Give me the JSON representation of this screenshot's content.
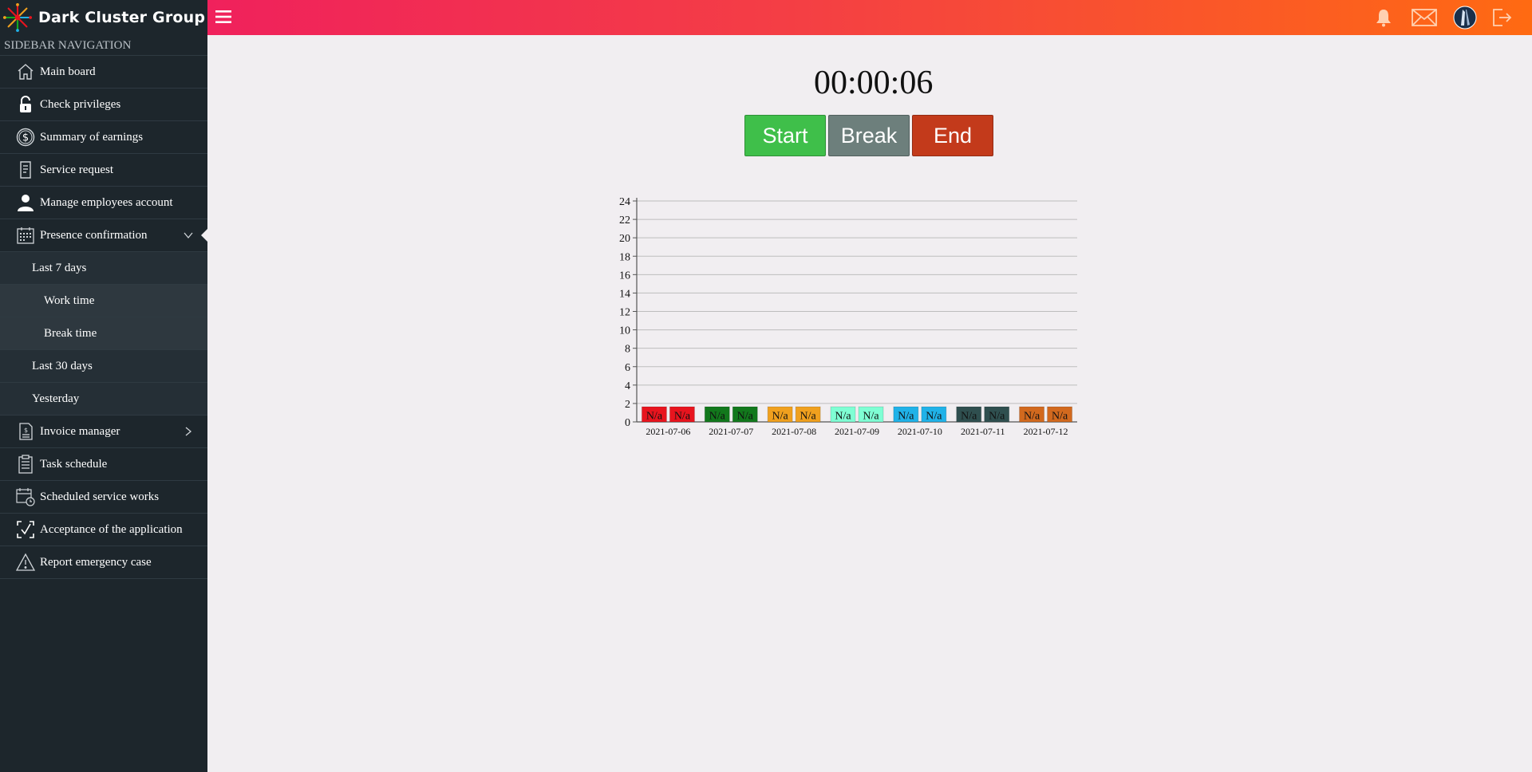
{
  "brand": {
    "name": "Dark Cluster Group"
  },
  "sidebar": {
    "heading": "SIDEBAR NAVIGATION",
    "items": [
      {
        "label": "Main board",
        "icon": "home-icon"
      },
      {
        "label": "Check privileges",
        "icon": "lock-icon"
      },
      {
        "label": "Summary of earnings",
        "icon": "dollar-icon"
      },
      {
        "label": "Service request",
        "icon": "document-icon"
      },
      {
        "label": "Manage employees account",
        "icon": "user-icon"
      },
      {
        "label": "Presence confirmation",
        "icon": "calendar-icon"
      },
      {
        "label": "Invoice manager",
        "icon": "invoice-icon"
      },
      {
        "label": "Task schedule",
        "icon": "clipboard-icon"
      },
      {
        "label": "Scheduled service works",
        "icon": "calendar-clock-icon"
      },
      {
        "label": "Acceptance of the application",
        "icon": "check-frame-icon"
      },
      {
        "label": "Report emergency case",
        "icon": "warning-icon"
      }
    ],
    "presence_sub": {
      "last7": "Last 7 days",
      "work_time": "Work time",
      "break_time": "Break time",
      "last30": "Last 30 days",
      "yesterday": "Yesterday"
    }
  },
  "timer": {
    "value": "00:00:06"
  },
  "buttons": {
    "start": "Start",
    "break": "Break",
    "end": "End"
  },
  "colors": {
    "start": "#3fbf4a",
    "break": "#6d7f7c",
    "end": "#c33a1b"
  },
  "chart_data": {
    "type": "bar",
    "categories": [
      "2021-07-06",
      "2021-07-07",
      "2021-07-08",
      "2021-07-09",
      "2021-07-10",
      "2021-07-11",
      "2021-07-12"
    ],
    "bar_colors": [
      "#e8141e",
      "#12781c",
      "#f0a01e",
      "#7fffd4",
      "#20b2e8",
      "#2f4f4f",
      "#d2691e"
    ],
    "series": [
      {
        "values": [
          null,
          null,
          null,
          null,
          null,
          null,
          null
        ],
        "labels": [
          "N/a",
          "N/a",
          "N/a",
          "N/a",
          "N/a",
          "N/a",
          "N/a"
        ]
      },
      {
        "values": [
          null,
          null,
          null,
          null,
          null,
          null,
          null
        ],
        "labels": [
          "N/a",
          "N/a",
          "N/a",
          "N/a",
          "N/a",
          "N/a",
          "N/a"
        ]
      }
    ],
    "yticks": [
      0,
      2,
      4,
      6,
      8,
      10,
      12,
      14,
      16,
      18,
      20,
      22,
      24
    ],
    "ylim": [
      0,
      24
    ],
    "title": "",
    "xlabel": "",
    "ylabel": "",
    "grid": true
  }
}
